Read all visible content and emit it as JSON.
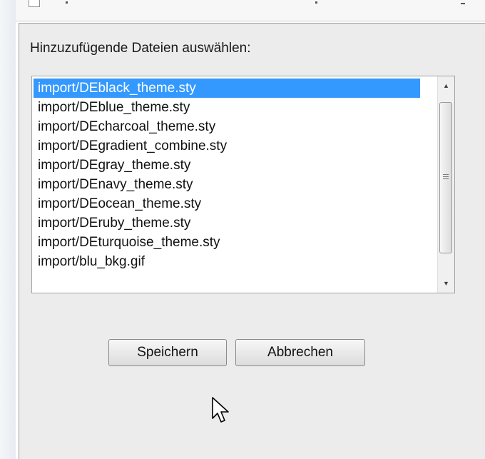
{
  "dialog": {
    "prompt": "Hinzuzufügende Dateien auswählen:",
    "files": [
      "import/DEblack_theme.sty",
      "import/DEblue_theme.sty",
      "import/DEcharcoal_theme.sty",
      "import/DEgradient_combine.sty",
      "import/DEgray_theme.sty",
      "import/DEnavy_theme.sty",
      "import/DEocean_theme.sty",
      "import/DEruby_theme.sty",
      "import/DEturquoise_theme.sty",
      "import/blu_bkg.gif"
    ],
    "selected_index": 0,
    "save_label": "Speichern",
    "cancel_label": "Abbrechen"
  },
  "icons": {
    "scroll_up": "scroll-up-arrow-icon",
    "scroll_down": "scroll-down-arrow-icon",
    "cursor": "mouse-pointer-icon"
  },
  "colors": {
    "selection": "#3399ff",
    "dialog_background": "#ececec"
  }
}
